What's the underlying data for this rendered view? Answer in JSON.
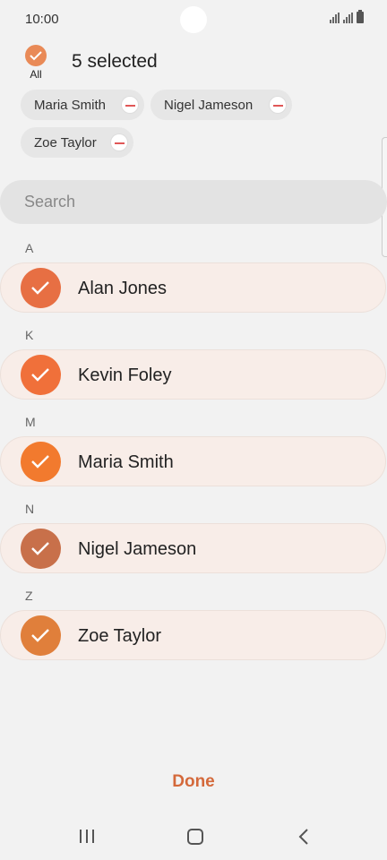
{
  "status_bar": {
    "time": "10:00"
  },
  "header": {
    "all_label": "All",
    "selected_text": "5 selected",
    "accent": "#e98a57"
  },
  "chips": [
    "Maria Smith",
    "Nigel Jameson",
    "Zoe Taylor"
  ],
  "search": {
    "placeholder": "Search"
  },
  "sections": [
    {
      "letter": "A",
      "contact": "Alan Jones",
      "avatar_color": "#e76f43"
    },
    {
      "letter": "K",
      "contact": "Kevin Foley",
      "avatar_color": "#f0703a"
    },
    {
      "letter": "M",
      "contact": "Maria Smith",
      "avatar_color": "#f27a2e"
    },
    {
      "letter": "N",
      "contact": "Nigel Jameson",
      "avatar_color": "#c8704a"
    },
    {
      "letter": "Z",
      "contact": "Zoe Taylor",
      "avatar_color": "#e07f3b"
    }
  ],
  "done_label": "Done",
  "navbar": {
    "icons": [
      "recent-apps-icon",
      "home-icon",
      "back-icon"
    ]
  }
}
